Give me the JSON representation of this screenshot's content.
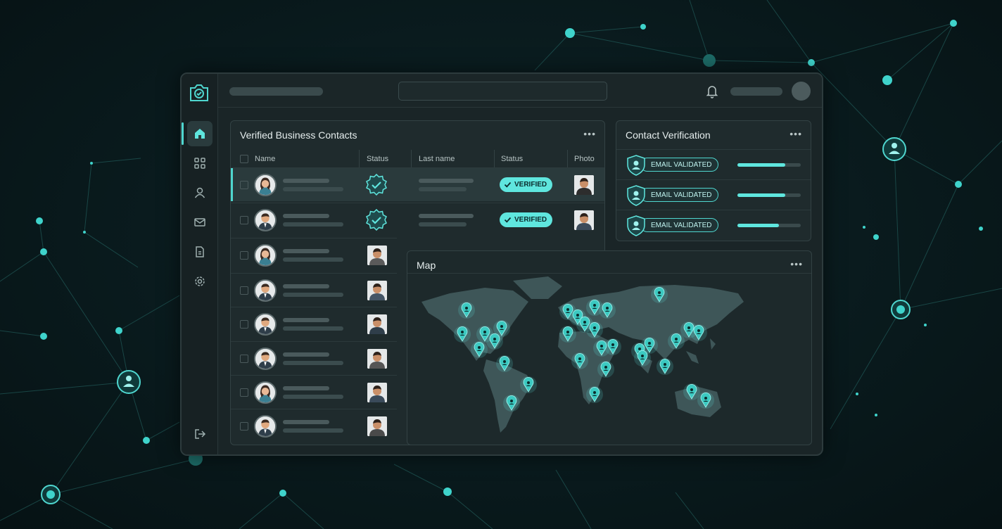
{
  "theme": {
    "accent": "#5fe6de",
    "panel": "#1f2b2d",
    "background": "#061214"
  },
  "nav": {
    "items": [
      {
        "icon": "home-icon"
      },
      {
        "icon": "grid-icon"
      },
      {
        "icon": "user-icon"
      },
      {
        "icon": "mail-icon"
      },
      {
        "icon": "document-icon"
      },
      {
        "icon": "settings-icon"
      }
    ],
    "bottom_icon": "logout-icon"
  },
  "topbar": {
    "notification_icon": "bell-icon"
  },
  "contacts": {
    "title": "Verified Business Contacts",
    "menu": "•••",
    "columns": {
      "name": "Name",
      "status": "Status",
      "last_name": "Last name",
      "status2": "Status",
      "photo": "Photo"
    },
    "verified_label": "VERIFIED",
    "rows": [
      {
        "highlighted": true,
        "verified": true,
        "gender": "f"
      },
      {
        "highlighted": false,
        "verified": true,
        "gender": "m"
      },
      {
        "highlighted": false,
        "verified": false,
        "gender": "f"
      },
      {
        "highlighted": false,
        "verified": false,
        "gender": "m"
      },
      {
        "highlighted": false,
        "verified": false,
        "gender": "m"
      },
      {
        "highlighted": false,
        "verified": false,
        "gender": "m"
      },
      {
        "highlighted": false,
        "verified": false,
        "gender": "f"
      },
      {
        "highlighted": false,
        "verified": false,
        "gender": "m"
      }
    ]
  },
  "verification": {
    "title": "Contact Verification",
    "menu": "•••",
    "items": [
      {
        "label": "EMAIL VALIDATED",
        "progress": 0.75
      },
      {
        "label": "EMAIL VALIDATED",
        "progress": 0.75
      },
      {
        "label": "EMAIL VALIDATED",
        "progress": 0.65
      }
    ]
  },
  "map": {
    "title": "Map",
    "menu": "•••"
  }
}
